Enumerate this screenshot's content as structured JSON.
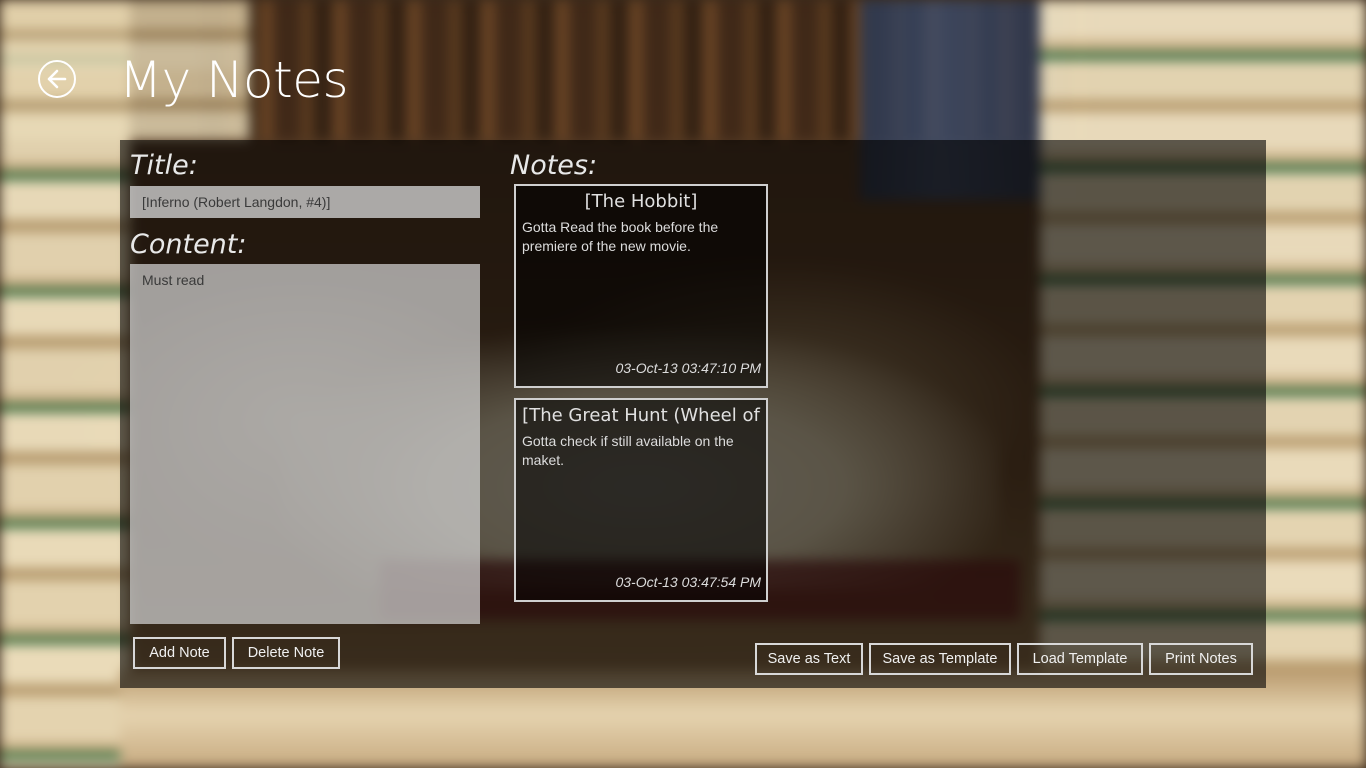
{
  "header": {
    "title": "My Notes"
  },
  "editor": {
    "title_label": "Title:",
    "title_value": "[Inferno (Robert Langdon, #4)]",
    "content_label": "Content:",
    "content_value": "Must read"
  },
  "notes": {
    "label": "Notes:",
    "items": [
      {
        "title": "[The Hobbit]",
        "body": "Gotta Read the book before the premiere of the new movie.",
        "timestamp": "03-Oct-13 03:47:10 PM"
      },
      {
        "title": "[The Great Hunt (Wheel of",
        "body": "Gotta check if still available on the maket.",
        "timestamp": "03-Oct-13 03:47:54 PM"
      }
    ]
  },
  "actions": {
    "add_note": "Add Note",
    "delete_note": "Delete Note",
    "save_as_text": "Save as Text",
    "save_as_template": "Save as Template",
    "load_template": "Load Template",
    "print_notes": "Print Notes"
  },
  "icons": {
    "back": "back-arrow-icon"
  },
  "colors": {
    "panel_bg": "#000000",
    "input_bg": "#d2d2d2",
    "button_border": "#d8d8d8",
    "text": "#ffffff"
  }
}
